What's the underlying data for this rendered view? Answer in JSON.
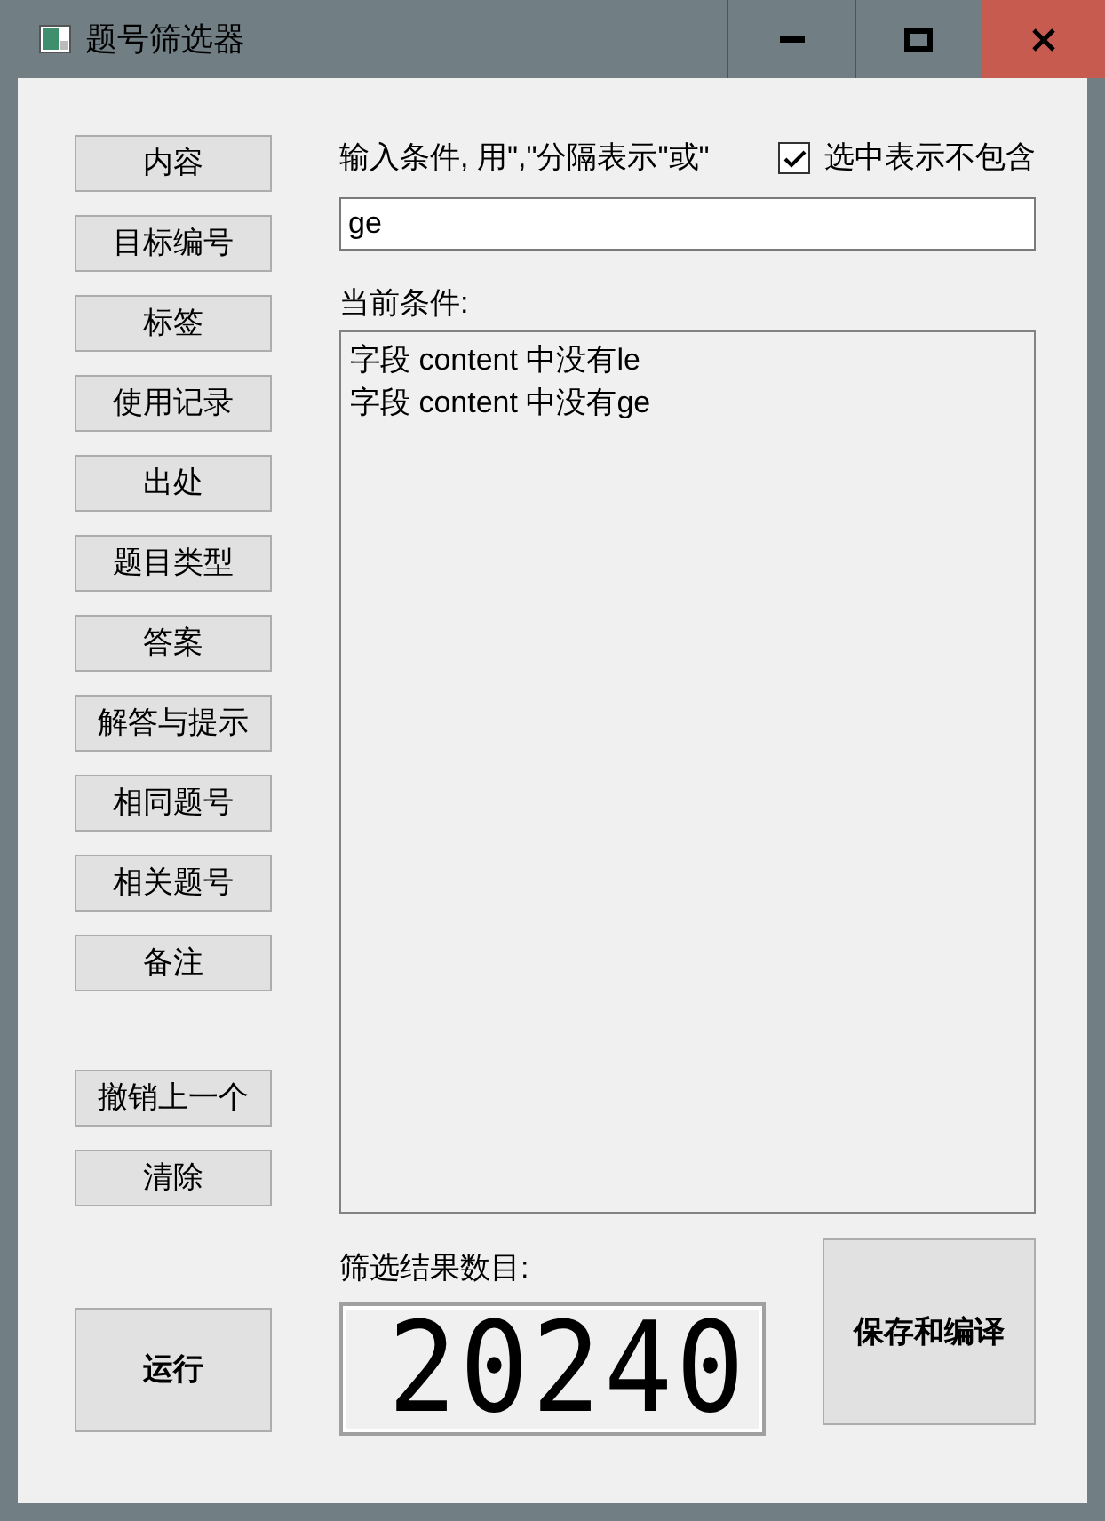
{
  "window": {
    "title": "题号筛选器"
  },
  "field_buttons": [
    "内容",
    "目标编号",
    "标签",
    "使用记录",
    "出处",
    "题目类型",
    "答案",
    "解答与提示",
    "相同题号",
    "相关题号",
    "备注"
  ],
  "undo_button": "撤销上一个",
  "clear_button": "清除",
  "run_button": "运行",
  "instruction": "输入条件, 用\",\"分隔表示\"或\"",
  "exclude_checkbox": {
    "label": "选中表示不包含",
    "checked": true
  },
  "condition_input": {
    "value": "ge"
  },
  "current_conditions_label": "当前条件:",
  "conditions": [
    "字段 content 中没有le",
    "字段 content 中没有ge"
  ],
  "result_count_label": "筛选结果数目:",
  "result_count": "20240",
  "save_button": "保存和编译"
}
